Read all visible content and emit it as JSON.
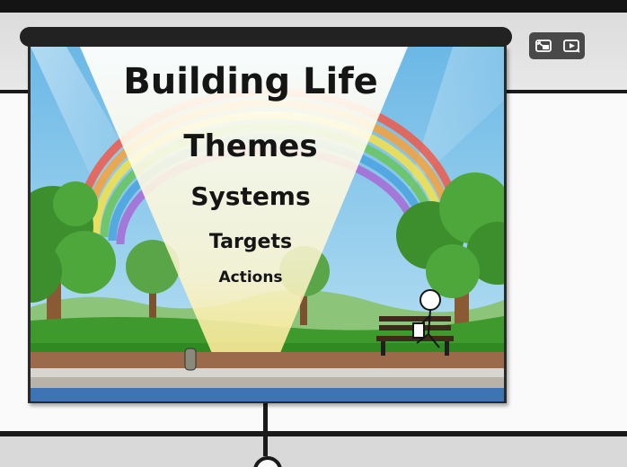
{
  "slide": {
    "title": "Building Life",
    "levels": [
      "Themes",
      "Systems",
      "Targets",
      "Actions"
    ]
  },
  "video_controls": {
    "buttons": [
      "exit-fullscreen-icon",
      "play-next-icon"
    ]
  },
  "colors": {
    "sky": "#7fc3e8",
    "grass": "#3f9a2e",
    "spotlight": "#fff8dc",
    "frame": "#222222"
  }
}
